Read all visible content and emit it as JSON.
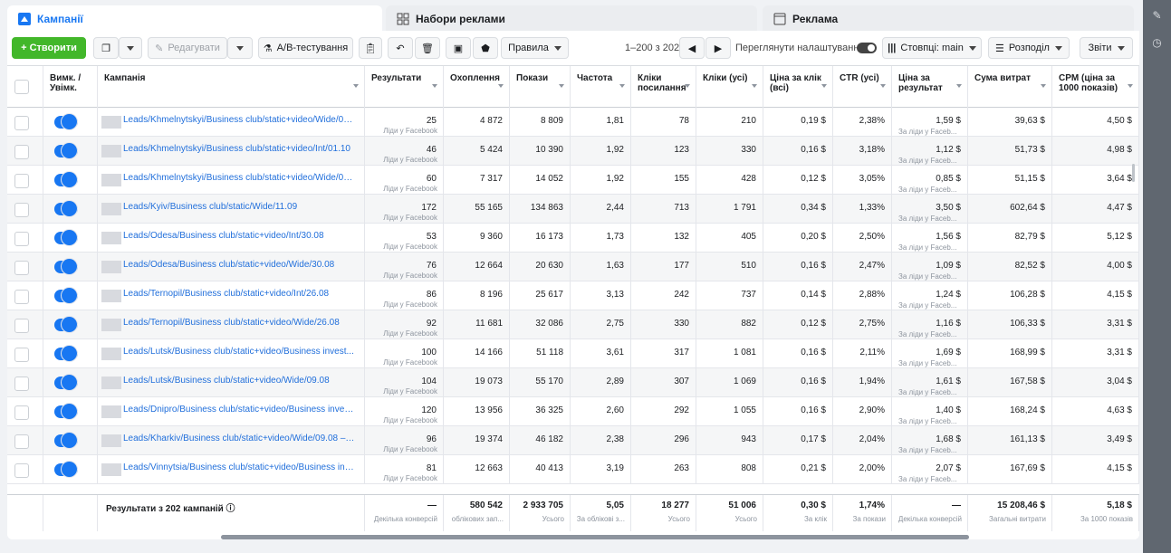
{
  "tabs": [
    {
      "label": "Кампанії"
    },
    {
      "label": "Набори реклами"
    },
    {
      "label": "Реклама"
    }
  ],
  "toolbar": {
    "create": "+ Створити",
    "edit": "Редагувати",
    "ab_test": "A/B-тестування",
    "rules": "Правила",
    "pagination": "1–200 з 202",
    "view_settings": "Переглянути налаштування",
    "columns": "Стовпці: main",
    "breakdown": "Розподіл",
    "reports": "Звіти"
  },
  "columns": [
    "Вимк. / Увімк.",
    "Кампанія",
    "Результати",
    "Охоплення",
    "Покази",
    "Частота",
    "Кліки посилання",
    "Кліки (усі)",
    "Ціна за клік (всі)",
    "CTR (усі)",
    "Ціна за результат",
    "Сума витрат",
    "CPM (ціна за 1000 показів)"
  ],
  "sub_label": "Ліди у Facebook",
  "cpr_sub": "За ліди у Faceb...",
  "rows": [
    {
      "campaign": "Leads/Khmelnytskyi/Business club/static+video/Wide/04...",
      "results": "25",
      "reach": "4 872",
      "impressions": "8 809",
      "frequency": "1,81",
      "link_clicks": "78",
      "clicks_all": "210",
      "cpc": "0,19 $",
      "ctr": "2,38%",
      "cpr": "1,59 $",
      "spend": "39,63 $",
      "cpm": "4,50 $"
    },
    {
      "campaign": "Leads/Khmelnytskyi/Business club/static+video/Int/01.10",
      "results": "46",
      "reach": "5 424",
      "impressions": "10 390",
      "frequency": "1,92",
      "link_clicks": "123",
      "clicks_all": "330",
      "cpc": "0,16 $",
      "ctr": "3,18%",
      "cpr": "1,12 $",
      "spend": "51,73 $",
      "cpm": "4,98 $"
    },
    {
      "campaign": "Leads/Khmelnytskyi/Business club/static+video/Wide/01...",
      "results": "60",
      "reach": "7 317",
      "impressions": "14 052",
      "frequency": "1,92",
      "link_clicks": "155",
      "clicks_all": "428",
      "cpc": "0,12 $",
      "ctr": "3,05%",
      "cpr": "0,85 $",
      "spend": "51,15 $",
      "cpm": "3,64 $"
    },
    {
      "campaign": "Leads/Kyiv/Business club/static/Wide/11.09",
      "results": "172",
      "reach": "55 165",
      "impressions": "134 863",
      "frequency": "2,44",
      "link_clicks": "713",
      "clicks_all": "1 791",
      "cpc": "0,34 $",
      "ctr": "1,33%",
      "cpr": "3,50 $",
      "spend": "602,64 $",
      "cpm": "4,47 $"
    },
    {
      "campaign": "Leads/Odesa/Business club/static+video/Int/30.08",
      "results": "53",
      "reach": "9 360",
      "impressions": "16 173",
      "frequency": "1,73",
      "link_clicks": "132",
      "clicks_all": "405",
      "cpc": "0,20 $",
      "ctr": "2,50%",
      "cpr": "1,56 $",
      "spend": "82,79 $",
      "cpm": "5,12 $"
    },
    {
      "campaign": "Leads/Odesa/Business club/static+video/Wide/30.08",
      "results": "76",
      "reach": "12 664",
      "impressions": "20 630",
      "frequency": "1,63",
      "link_clicks": "177",
      "clicks_all": "510",
      "cpc": "0,16 $",
      "ctr": "2,47%",
      "cpr": "1,09 $",
      "spend": "82,52 $",
      "cpm": "4,00 $"
    },
    {
      "campaign": "Leads/Ternopil/Business club/static+video/Int/26.08",
      "results": "86",
      "reach": "8 196",
      "impressions": "25 617",
      "frequency": "3,13",
      "link_clicks": "242",
      "clicks_all": "737",
      "cpc": "0,14 $",
      "ctr": "2,88%",
      "cpr": "1,24 $",
      "spend": "106,28 $",
      "cpm": "4,15 $"
    },
    {
      "campaign": "Leads/Ternopil/Business club/static+video/Wide/26.08",
      "results": "92",
      "reach": "11 681",
      "impressions": "32 086",
      "frequency": "2,75",
      "link_clicks": "330",
      "clicks_all": "882",
      "cpc": "0,12 $",
      "ctr": "2,75%",
      "cpr": "1,16 $",
      "spend": "106,33 $",
      "cpm": "3,31 $"
    },
    {
      "campaign": "Leads/Lutsk/Business club/static+video/Business invest...",
      "results": "100",
      "reach": "14 166",
      "impressions": "51 118",
      "frequency": "3,61",
      "link_clicks": "317",
      "clicks_all": "1 081",
      "cpc": "0,16 $",
      "ctr": "2,11%",
      "cpr": "1,69 $",
      "spend": "168,99 $",
      "cpm": "3,31 $"
    },
    {
      "campaign": "Leads/Lutsk/Business club/static+video/Wide/09.08",
      "results": "104",
      "reach": "19 073",
      "impressions": "55 170",
      "frequency": "2,89",
      "link_clicks": "307",
      "clicks_all": "1 069",
      "cpc": "0,16 $",
      "ctr": "1,94%",
      "cpr": "1,61 $",
      "spend": "167,58 $",
      "cpm": "3,04 $"
    },
    {
      "campaign": "Leads/Dnipro/Business club/static+video/Business inves...",
      "results": "120",
      "reach": "13 956",
      "impressions": "36 325",
      "frequency": "2,60",
      "link_clicks": "292",
      "clicks_all": "1 055",
      "cpc": "0,16 $",
      "ctr": "2,90%",
      "cpr": "1,40 $",
      "spend": "168,24 $",
      "cpm": "4,63 $"
    },
    {
      "campaign": "Leads/Kharkiv/Business club/static+video/Wide/09.08 – ...",
      "results": "96",
      "reach": "19 374",
      "impressions": "46 182",
      "frequency": "2,38",
      "link_clicks": "296",
      "clicks_all": "943",
      "cpc": "0,17 $",
      "ctr": "2,04%",
      "cpr": "1,68 $",
      "spend": "161,13 $",
      "cpm": "3,49 $"
    },
    {
      "campaign": "Leads/Vinnytsia/Business club/static+video/Business inv...",
      "results": "81",
      "reach": "12 663",
      "impressions": "40 413",
      "frequency": "3,19",
      "link_clicks": "263",
      "clicks_all": "808",
      "cpc": "0,21 $",
      "ctr": "2,00%",
      "cpr": "2,07 $",
      "spend": "167,69 $",
      "cpm": "4,15 $"
    }
  ],
  "footer": {
    "label": "Результати з 202 кампаній",
    "results": "—",
    "results_sub": "Декілька конверсій",
    "reach": "580 542",
    "reach_sub": "облікових зап...",
    "impressions": "2 933 705",
    "impressions_sub": "Усього",
    "frequency": "5,05",
    "frequency_sub": "За облікові з...",
    "link_clicks": "18 277",
    "link_clicks_sub": "Усього",
    "clicks_all": "51 006",
    "clicks_all_sub": "Усього",
    "cpc": "0,30 $",
    "cpc_sub": "За клік",
    "ctr": "1,74%",
    "ctr_sub": "За покази",
    "cpr": "—",
    "cpr_sub": "Декілька конверсій",
    "spend": "15 208,46 $",
    "spend_sub": "Загальні витрати",
    "cpm": "5,18 $",
    "cpm_sub": "За 1000 показів"
  },
  "colors": {
    "accent": "#1877f2",
    "green": "#42b72a",
    "link": "#216fdb"
  }
}
